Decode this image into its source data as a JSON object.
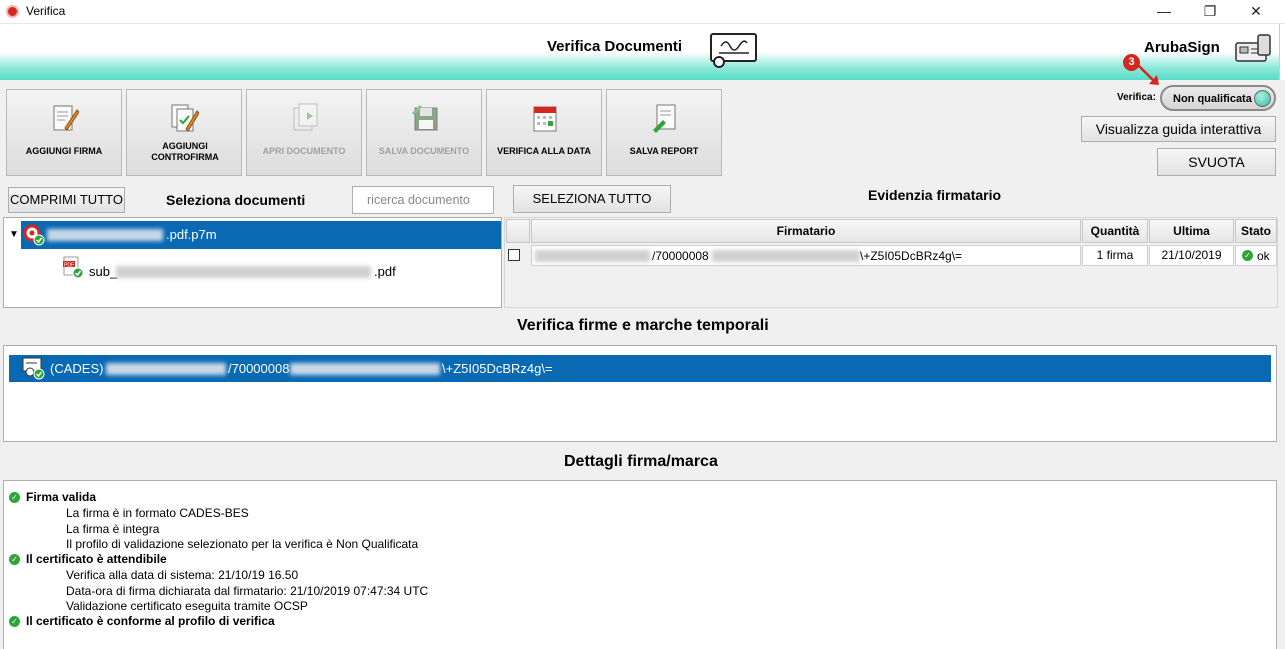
{
  "window": {
    "title": "Verifica"
  },
  "header": {
    "title": "Verifica Documenti",
    "brand": "ArubaSign"
  },
  "toolbar": [
    {
      "label": "AGGIUNGI FIRMA",
      "enabled": true,
      "icon": "pen-document-icon"
    },
    {
      "label": "AGGIUNGI CONTROFIRMA",
      "enabled": true,
      "icon": "countersign-icon"
    },
    {
      "label": "APRI DOCUMENTO",
      "enabled": false,
      "icon": "open-document-icon"
    },
    {
      "label": "SALVA DOCUMENTO",
      "enabled": false,
      "icon": "floppy-disk-icon"
    },
    {
      "label": "VERIFICA ALLA DATA",
      "enabled": true,
      "icon": "calendar-icon"
    },
    {
      "label": "SALVA REPORT",
      "enabled": true,
      "icon": "report-icon"
    }
  ],
  "verifica": {
    "label": "Verifica:",
    "value": "Non qualificata"
  },
  "annotation_badge": "3",
  "buttons": {
    "guide": "Visualizza guida interattiva",
    "svuota": "SVUOTA",
    "comprimi": "COMPRIMI TUTTO",
    "seleziona_tutto": "SELEZIONA TUTTO"
  },
  "documents": {
    "title": "Seleziona documenti",
    "search_placeholder": "ricerca documento",
    "root_suffix": ".pdf.p7m",
    "child_prefix": "sub_",
    "child_suffix": ".pdf"
  },
  "signers": {
    "title": "Evidenzia firmatario",
    "columns": [
      "Firmatario",
      "Quantità",
      "Ultima",
      "Stato"
    ],
    "rows": [
      {
        "firmatario_mid": "/70000008",
        "firmatario_end": "\\+Z5I05DcBRz4g\\=",
        "quantita": "1 firma",
        "ultima": "21/10/2019",
        "stato": "ok"
      }
    ]
  },
  "signatures": {
    "title": "Verifica firme e marche temporali",
    "row_prefix": "(CADES)",
    "row_mid": "/70000008",
    "row_end": "\\+Z5I05DcBRz4g\\="
  },
  "details": {
    "title": "Dettagli firma/marca",
    "groups": [
      {
        "heading": "Firma valida",
        "items": [
          "La firma è in formato CADES-BES",
          "La firma è integra",
          "Il profilo di validazione selezionato per la verifica è Non Qualificata"
        ]
      },
      {
        "heading": "Il certificato è attendibile",
        "items": [
          "Verifica alla data di sistema: 21/10/19 16.50",
          "Data-ora di firma dichiarata dal firmatario: 21/10/2019 07:47:34 UTC",
          "Validazione certificato eseguita tramite OCSP"
        ]
      },
      {
        "heading": "Il certificato è conforme al profilo di verifica",
        "items": []
      }
    ]
  },
  "colors": {
    "accent": "#0969b3",
    "teal": "#56dcc7",
    "ok": "#2ea43a",
    "badge": "#d7261d"
  }
}
